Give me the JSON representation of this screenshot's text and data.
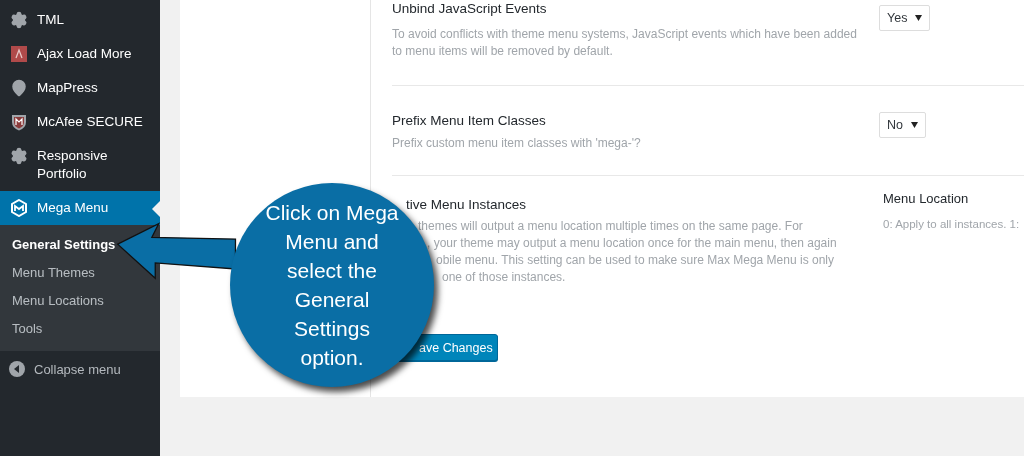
{
  "sidebar": {
    "items": [
      {
        "label": "TML",
        "selected": false
      },
      {
        "label": "Ajax Load More",
        "selected": false
      },
      {
        "label": "MapPress",
        "selected": false
      },
      {
        "label": "McAfee SECURE",
        "selected": false
      },
      {
        "label": "Responsive Portfolio",
        "selected": false
      },
      {
        "label": "Mega Menu",
        "selected": true,
        "children": [
          {
            "label": "General Settings",
            "selected": true
          },
          {
            "label": "Menu Themes",
            "selected": false
          },
          {
            "label": "Menu Locations",
            "selected": false
          },
          {
            "label": "Tools",
            "selected": false
          }
        ]
      }
    ],
    "collapse": "Collapse menu"
  },
  "settings": [
    {
      "title": "Unbind JavaScript Events",
      "description": [
        "To avoid conflicts with theme menu systems, JavaScript events which have been added",
        "to menu items will be removed by default."
      ],
      "control": {
        "kind": "select",
        "value": "Yes"
      }
    },
    {
      "title": "Prefix Menu Item Classes",
      "description": [
        "Prefix custom menu item classes with 'mega-'?"
      ],
      "control": {
        "kind": "select",
        "value": "No"
      }
    },
    {
      "title": "tive Menu Instances",
      "description": [
        "themes will output a menu location multiple times on the same page. For",
        ", your theme may output a menu location once for the main menu, then again",
        "obile menu. This setting can be used to make sure Max Mega Menu is only",
        "one of those instances."
      ],
      "control": {
        "kind": "column",
        "heading": "Menu Location",
        "text": "0: Apply to all instances. 1:"
      }
    }
  ],
  "save_button": "ave Changes",
  "callout": "Click on Mega Menu and select the General Settings option."
}
